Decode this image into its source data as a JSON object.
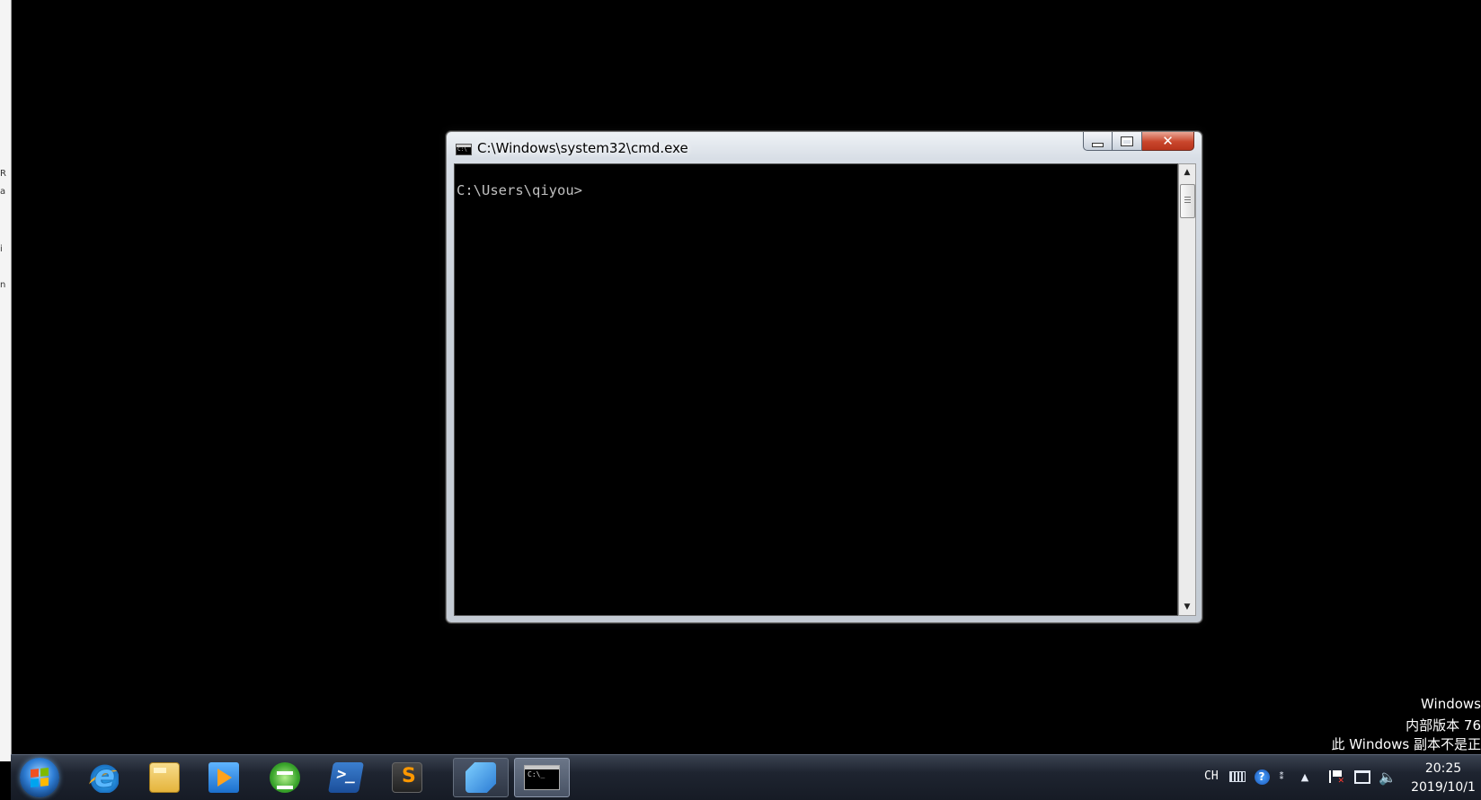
{
  "window": {
    "title": "C:\\Windows\\system32\\cmd.exe",
    "console_text": "C:\\Users\\qiyou>",
    "close_label": "✕"
  },
  "watermark": {
    "line1": "Windows",
    "line2": "内部版本 76",
    "line3": "此 Windows 副本不是正"
  },
  "taskbar": {
    "apps": [
      "start-menu",
      "internet-explorer",
      "windows-explorer",
      "windows-media-player",
      "green-app",
      "powershell",
      "sublime-text",
      "registry-editor",
      "command-prompt"
    ],
    "language": "CH",
    "time": "20:25",
    "date": "2019/10/1"
  },
  "left_strip": {
    "fragments": [
      "R",
      "a",
      "i",
      "n"
    ]
  }
}
